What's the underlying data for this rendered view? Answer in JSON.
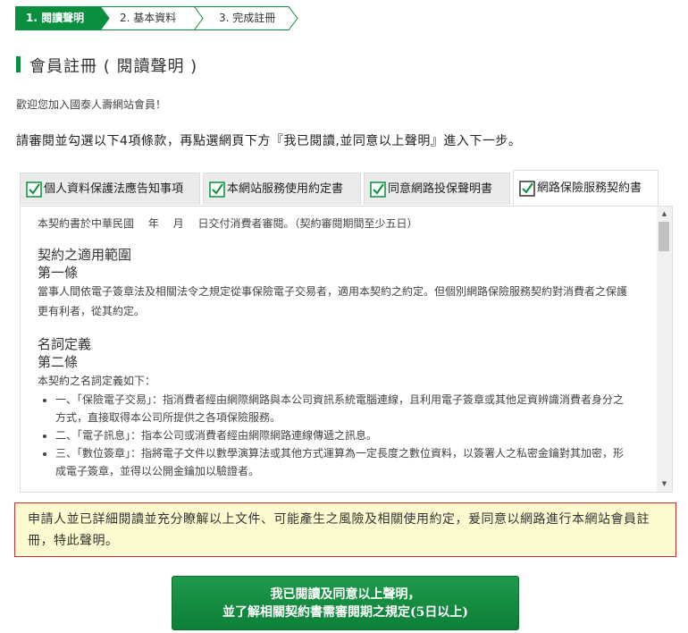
{
  "steps": [
    {
      "label": "1. 閱讀聲明",
      "state": "active"
    },
    {
      "label": "2. 基本資料",
      "state": "inactive"
    },
    {
      "label": "3. 完成註冊",
      "state": "inactive"
    }
  ],
  "page": {
    "title": "會員註冊 ( 閱讀聲明 )",
    "welcome": "歡迎您加入國泰人壽網站會員！",
    "instruction": "請審閱並勾選以下4項條款，再點選網頁下方『我已閱讀,並同意以上聲明』進入下一步。"
  },
  "tabs": [
    {
      "label": "個人資料保護法應告知事項",
      "checked": true
    },
    {
      "label": "本網站服務使用約定書",
      "checked": true
    },
    {
      "label": "同意網路投保聲明書",
      "checked": true
    },
    {
      "label": "網路保險服務契約書",
      "checked": true,
      "active": true
    }
  ],
  "contract": {
    "intro": "本契約書於中華民國　 年　 月　 日交付消費者審閱。（契約審閱期間至少五日）",
    "sec1_title": "契約之適用範圍",
    "sec1_article": "第一條",
    "sec1_body": "當事人間依電子簽章法及相關法令之規定從事保險電子交易者，適用本契約之約定。但個別網路保險服務契約對消費者之保護更有利者，從其約定。",
    "sec2_title": "名詞定義",
    "sec2_article": "第二條",
    "sec2_body": "本契約之名詞定義如下：",
    "items": [
      "一、「保險電子交易」：指消費者經由網際網路與本公司資訊系統電腦連線，且利用電子簽章或其他足資辨識消費者身分之方式，直接取得本公司所提供之各項保險服務。",
      "二、「電子訊息」：指本公司或消費者經由網際網路連線傳遞之訊息。",
      "三、「數位簽章」：指將電子文件以數學演算法或其他方式運算為一定長度之數位資料，以簽署人之私密金鑰對其加密，形成電子簽章，並得以公開金鑰加以驗證者。"
    ]
  },
  "declaration": "申請人並已詳細閱讀並充分瞭解以上文件、可能產生之風險及相關使用約定，爰同意以網路進行本網站會員註冊，特此聲明。",
  "button": {
    "line1": "我已閱讀及同意以上聲明，",
    "line2": "並了解相關契約書需審閱期之規定(5日以上)"
  },
  "colors": {
    "brand_green": "#0a8f3f",
    "warning_bg": "#fdfbd0",
    "warning_border": "#c9302c"
  }
}
